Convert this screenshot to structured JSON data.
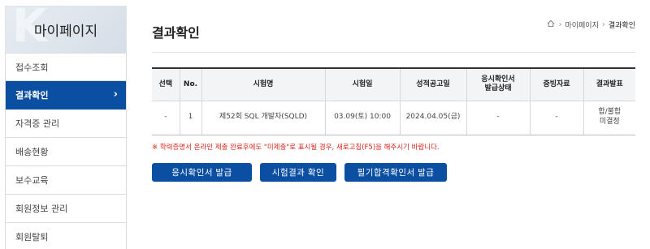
{
  "sidebar": {
    "watermark": "K",
    "title": "마이페이지",
    "items": [
      {
        "label": "접수조회",
        "active": false
      },
      {
        "label": "결과확인",
        "active": true
      },
      {
        "label": "자격증 관리",
        "active": false
      },
      {
        "label": "배송현황",
        "active": false
      },
      {
        "label": "보수교육",
        "active": false
      },
      {
        "label": "회원정보 관리",
        "active": false
      },
      {
        "label": "회원탈퇴",
        "active": false
      }
    ],
    "active_chevron": "›"
  },
  "header": {
    "title": "결과확인",
    "breadcrumb": {
      "home_icon": "home-icon",
      "items": [
        "마이페이지",
        "결과확인"
      ]
    }
  },
  "table": {
    "columns": [
      "선택",
      "No.",
      "시험명",
      "시험일",
      "성적공고일",
      "응시확인서\n발급상태",
      "증빙자료",
      "결과발표"
    ],
    "rows": [
      {
        "select": "-",
        "no": "1",
        "exam_name": "제52회 SQL 개발자(SQLD)",
        "exam_date": "03.09(토) 10:00",
        "announce_date": "2024.04.05(금)",
        "cert_status": "-",
        "evidence": "-",
        "result": "합/불합\n미결정"
      }
    ]
  },
  "notice": "※ 학력증명서 온라인 제출 완료후에도 \"미제출\"로 표시될 경우, 새로고침(F5)을 해주시기 바랍니다.",
  "buttons": {
    "confirm_issue": "응시확인서 발급",
    "check_result": "시험결과 확인",
    "written_pass_issue": "필기합격확인서 발급"
  },
  "colors": {
    "accent": "#0b4fa3",
    "notice": "#d9261c"
  }
}
